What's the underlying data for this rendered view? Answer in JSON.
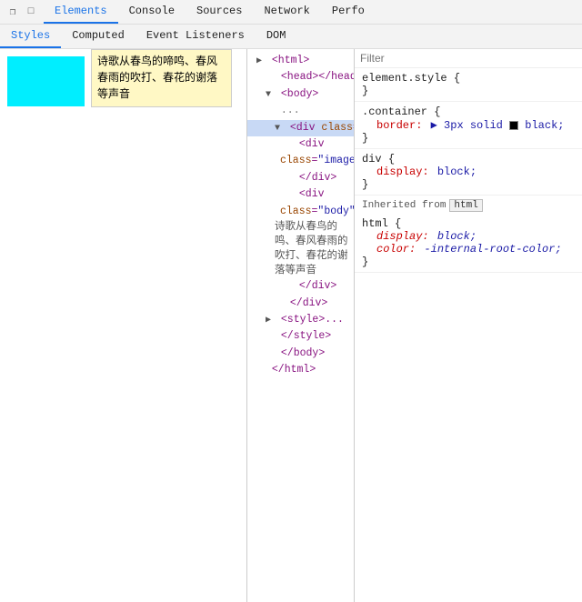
{
  "toolbar": {
    "tabs": [
      {
        "label": "Elements",
        "active": true
      },
      {
        "label": "Console",
        "active": false
      },
      {
        "label": "Sources",
        "active": false
      },
      {
        "label": "Network",
        "active": false
      },
      {
        "label": "Perfo",
        "active": false
      }
    ],
    "style_tabs": [
      {
        "label": "Styles",
        "active": true
      },
      {
        "label": "Computed",
        "active": false
      },
      {
        "label": "Event Listeners",
        "active": false
      },
      {
        "label": "DOM",
        "active": false
      }
    ]
  },
  "tooltip": {
    "text": "诗歌从春鸟的啼鸣、春风春雨的吹打、春花的谢落等声音"
  },
  "filter": {
    "placeholder": "Filter"
  },
  "styles": {
    "element_style": {
      "selector": "element.style",
      "rules": []
    },
    "container_rule": {
      "selector": ".container",
      "rules": [
        {
          "prop": "border:",
          "val": "3px solid",
          "color": "black",
          "has_color": true
        }
      ]
    },
    "div_rule": {
      "selector": "div",
      "rules": [
        {
          "prop": "display:",
          "val": "block"
        }
      ]
    },
    "html_rule": {
      "selector": "html",
      "rules": [
        {
          "prop": "display:",
          "val": "block;",
          "italic": true
        },
        {
          "prop": "color:",
          "val": "-internal-root-color;",
          "italic": true
        }
      ]
    }
  },
  "dom": {
    "lines": [
      {
        "indent": 1,
        "html": "<html>",
        "type": "tag",
        "triangle": "▶"
      },
      {
        "indent": 2,
        "html": "<head></head>",
        "type": "tag",
        "triangle": ""
      },
      {
        "indent": 2,
        "html": "<body>",
        "type": "tag",
        "triangle": "▼"
      },
      {
        "indent": 2,
        "ellipsis": "...",
        "type": "ellipsis"
      },
      {
        "indent": 3,
        "selected": true,
        "html": "<div class=\"container\">",
        "type": "tag",
        "triangle": "▼"
      },
      {
        "indent": 4,
        "html": "<div",
        "type": "tag-open",
        "triangle": ""
      },
      {
        "indent": 4,
        "cont": "class=",
        "cont2": "\"image\">",
        "type": "attr"
      },
      {
        "indent": 4,
        "html": "</div>",
        "type": "tag",
        "triangle": ""
      },
      {
        "indent": 4,
        "html": "<div",
        "type": "tag-open2",
        "triangle": ""
      },
      {
        "indent": 4,
        "cont": "class=",
        "cont2": "\"body\">",
        "type": "attr2"
      },
      {
        "indent": 4,
        "body_text": "诗歌从春鸟的鸣、春风春雨的吹打、春花的谢落等声音",
        "type": "text"
      },
      {
        "indent": 4,
        "html": "</div>",
        "type": "tag",
        "triangle": ""
      },
      {
        "indent": 3,
        "html": "</div>",
        "type": "tag"
      },
      {
        "indent": 2,
        "html": "<style>...",
        "type": "tag",
        "triangle": "▶"
      },
      {
        "indent": 2,
        "html": "</style>",
        "type": "tag"
      },
      {
        "indent": 2,
        "html": "</body>",
        "type": "tag"
      },
      {
        "indent": 1,
        "html": "</html>",
        "type": "tag"
      }
    ]
  }
}
